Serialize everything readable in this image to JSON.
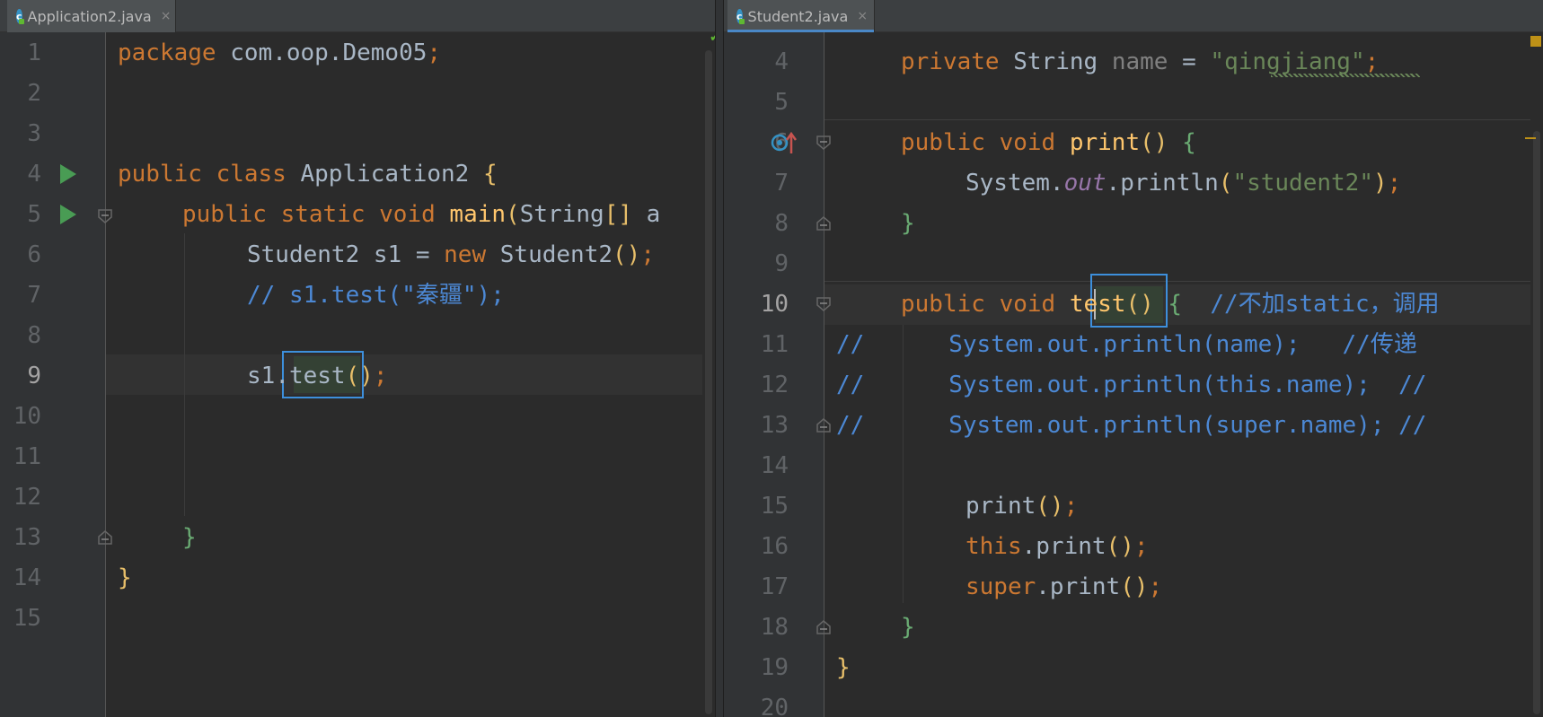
{
  "left_editor": {
    "tab": {
      "title": "Application2.java",
      "close": "×",
      "icon_letter": "c"
    },
    "lines": [
      {
        "n": "1"
      },
      {
        "n": "2"
      },
      {
        "n": "3"
      },
      {
        "n": "4"
      },
      {
        "n": "5"
      },
      {
        "n": "6"
      },
      {
        "n": "7"
      },
      {
        "n": "8"
      },
      {
        "n": "9"
      },
      {
        "n": "10"
      },
      {
        "n": "11"
      },
      {
        "n": "12"
      },
      {
        "n": "13"
      },
      {
        "n": "14"
      },
      {
        "n": "15"
      }
    ],
    "code": {
      "l1_kw": "package",
      "l1_rest": " com.oop.Demo05",
      "l1_semi": ";",
      "l4_kw": "public class",
      "l4_name": " Application2 ",
      "l4_brace": "{",
      "l5_kw": "public static void",
      "l5_fn": " main",
      "l5_paren": "(",
      "l5_type": "String",
      "l5_br": "[]",
      "l5_rest": " a",
      "l6_a": "Student2 s1 = ",
      "l6_kw": "new",
      "l6_b": " Student2",
      "l6_paren": "()",
      "l6_semi": ";",
      "l7_comment": "// s1.test(\"秦疆\");",
      "l9_a": "s1",
      "l9_dot": ".",
      "l9_method": "test",
      "l9_paren": "()",
      "l9_semi": ";",
      "l13_brace": "}",
      "l14_brace": "}"
    }
  },
  "right_editor": {
    "tab": {
      "title": "Student2.java",
      "close": "×",
      "icon_letter": "c"
    },
    "lines": [
      {
        "n": "4"
      },
      {
        "n": "5"
      },
      {
        "n": "6"
      },
      {
        "n": "7"
      },
      {
        "n": "8"
      },
      {
        "n": "9"
      },
      {
        "n": "10"
      },
      {
        "n": "11"
      },
      {
        "n": "12"
      },
      {
        "n": "13"
      },
      {
        "n": "14"
      },
      {
        "n": "15"
      },
      {
        "n": "16"
      },
      {
        "n": "17"
      },
      {
        "n": "18"
      },
      {
        "n": "19"
      },
      {
        "n": "20"
      }
    ],
    "code": {
      "l4_kw": "private",
      "l4_type": " String ",
      "l4_name": "name",
      "l4_eq": " = ",
      "l4_str_q1": "\"",
      "l4_str": "qingjiang",
      "l4_str_q2": "\"",
      "l4_semi": ";",
      "l6_kw": "public void",
      "l6_fn": " print",
      "l6_paren": "()",
      "l6_brace": " {",
      "l7_a": "System.",
      "l7_field": "out",
      "l7_b": ".println",
      "l7_p1": "(",
      "l7_str": "\"student2\"",
      "l7_p2": ")",
      "l7_semi": ";",
      "l8_brace": "}",
      "l10_kw": "public void",
      "l10_method": "test",
      "l10_paren": "()",
      "l10_brace": " {",
      "l10_comment": "  //不加static，调用",
      "l11_c": "//",
      "l11_code": "System.out.println(name);   //传递",
      "l12_c": "//",
      "l12_code": "System.out.println(this.name);  //",
      "l13_c": "//",
      "l13_code": "System.out.println(super.name); //",
      "l15_a": "print",
      "l15_p": "()",
      "l15_s": ";",
      "l16_kw": "this",
      "l16_a": ".print",
      "l16_p": "()",
      "l16_s": ";",
      "l17_kw": "super",
      "l17_a": ".print",
      "l17_p": "()",
      "l17_s": ";",
      "l18_brace": "}",
      "l19_brace": "}"
    }
  },
  "colors": {
    "background": "#2b2b2b",
    "keyword": "#cc7832",
    "function": "#ffc66d",
    "string": "#6a8759",
    "comment": "#4c88d4",
    "highlight_box": "#3d8fdc",
    "run_icon": "#499c54"
  },
  "icons": [
    "class-icon",
    "run-icon",
    "fold-icon",
    "override-icon",
    "check-icon",
    "close-icon"
  ]
}
